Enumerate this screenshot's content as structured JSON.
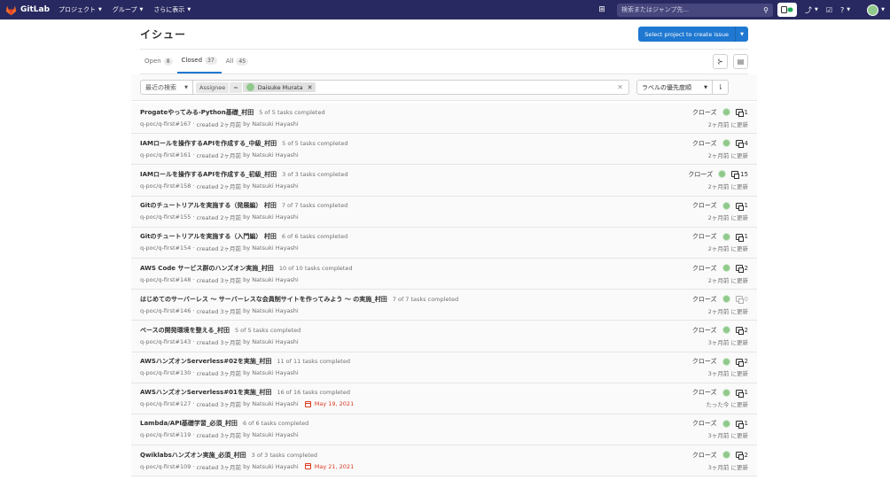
{
  "navbar": {
    "logo_text": "GitLab",
    "menu": [
      "プロジェクト",
      "グループ",
      "さらに表示"
    ],
    "search_placeholder": "検索またはジャンプ先...",
    "merge_requests_count": "",
    "todos_count": ""
  },
  "header": {
    "title": "イシュー",
    "primary_button": "Select project to create issue"
  },
  "tabs": [
    {
      "label": "Open",
      "count": "8"
    },
    {
      "label": "Closed",
      "count": "37"
    },
    {
      "label": "All",
      "count": "45"
    }
  ],
  "filter": {
    "recent_label": "最近の検索",
    "token_name": "Assignee",
    "token_operator": "=",
    "token_value": "Daisuke Murata",
    "sort_label": "ラベルの優先度順"
  },
  "issues": [
    {
      "title": "Progateやってみる-Python基礎_村田",
      "tasks": "5 of 5 tasks completed",
      "ref": "q-poc/q-first#167",
      "created": "created 2ヶ月前",
      "by": "by",
      "author": "Natsuki Hayashi",
      "due": "",
      "status": "クローズ",
      "comments": "1",
      "updated": "2ヶ月前 に更新"
    },
    {
      "title": "IAMロールを操作するAPIを作成する_中級_村田",
      "tasks": "5 of 5 tasks completed",
      "ref": "q-poc/q-first#161",
      "created": "created 2ヶ月前",
      "by": "by",
      "author": "Natsuki Hayashi",
      "due": "",
      "status": "クローズ",
      "comments": "4",
      "updated": "2ヶ月前 に更新"
    },
    {
      "title": "IAMロールを操作するAPIを作成する_初級_村田",
      "tasks": "3 of 3 tasks completed",
      "ref": "q-poc/q-first#158",
      "created": "created 2ヶ月前",
      "by": "by",
      "author": "Natsuki Hayashi",
      "due": "",
      "status": "クローズ",
      "comments": "15",
      "updated": "2ヶ月前 に更新"
    },
    {
      "title": "Gitのチュートリアルを実施する（発展編） 村田",
      "tasks": "7 of 7 tasks completed",
      "ref": "q-poc/q-first#155",
      "created": "created 2ヶ月前",
      "by": "by",
      "author": "Natsuki Hayashi",
      "due": "",
      "status": "クローズ",
      "comments": "1",
      "updated": "2ヶ月前 に更新"
    },
    {
      "title": "Gitのチュートリアルを実施する（入門編） 村田",
      "tasks": "6 of 6 tasks completed",
      "ref": "q-poc/q-first#154",
      "created": "created 2ヶ月前",
      "by": "by",
      "author": "Natsuki Hayashi",
      "due": "",
      "status": "クローズ",
      "comments": "1",
      "updated": "2ヶ月前 に更新"
    },
    {
      "title": "AWS Code サービス群のハンズオン実施_村田",
      "tasks": "10 of 10 tasks completed",
      "ref": "q-poc/q-first#148",
      "created": "created 3ヶ月前",
      "by": "by",
      "author": "Natsuki Hayashi",
      "due": "",
      "status": "クローズ",
      "comments": "2",
      "updated": "2ヶ月前 に更新"
    },
    {
      "title": "はじめてのサーバーレス ～ サーバーレスな会員制サイトを作ってみよう ～ の実施_村田",
      "tasks": "7 of 7 tasks completed",
      "ref": "q-poc/q-first#146",
      "created": "created 3ヶ月前",
      "by": "by",
      "author": "Natsuki Hayashi",
      "due": "",
      "status": "クローズ",
      "comments": "0",
      "updated": "2ヶ月前 に更新"
    },
    {
      "title": "ベースの開発環境を整える_村田",
      "tasks": "5 of 5 tasks completed",
      "ref": "q-poc/q-first#143",
      "created": "created 3ヶ月前",
      "by": "by",
      "author": "Natsuki Hayashi",
      "due": "",
      "status": "クローズ",
      "comments": "2",
      "updated": "3ヶ月前 に更新"
    },
    {
      "title": "AWSハンズオンServerless#02を実施_村田",
      "tasks": "11 of 11 tasks completed",
      "ref": "q-poc/q-first#130",
      "created": "created 3ヶ月前",
      "by": "by",
      "author": "Natsuki Hayashi",
      "due": "",
      "status": "クローズ",
      "comments": "2",
      "updated": "3ヶ月前 に更新"
    },
    {
      "title": "AWSハンズオンServerless#01を実施_村田",
      "tasks": "16 of 16 tasks completed",
      "ref": "q-poc/q-first#127",
      "created": "created 3ヶ月前",
      "by": "by",
      "author": "Natsuki Hayashi",
      "due": "May 19, 2021",
      "status": "クローズ",
      "comments": "1",
      "updated": "たった今 に更新"
    },
    {
      "title": "Lambda/API基礎学習_必須_村田",
      "tasks": "6 of 6 tasks completed",
      "ref": "q-poc/q-first#119",
      "created": "created 3ヶ月前",
      "by": "by",
      "author": "Natsuki Hayashi",
      "due": "",
      "status": "クローズ",
      "comments": "1",
      "updated": "3ヶ月前 に更新"
    },
    {
      "title": "Qwiklabsハンズオン実施_必須_村田",
      "tasks": "3 of 3 tasks completed",
      "ref": "q-poc/q-first#109",
      "created": "created 3ヶ月前",
      "by": "by",
      "author": "Natsuki Hayashi",
      "due": "May 21, 2021",
      "status": "クローズ",
      "comments": "2",
      "updated": "3ヶ月前 に更新"
    }
  ],
  "colors": {
    "navbar": "#292961",
    "primary": "#1f78d1",
    "due": "#db3b21",
    "avatar": "#8fc98b"
  }
}
